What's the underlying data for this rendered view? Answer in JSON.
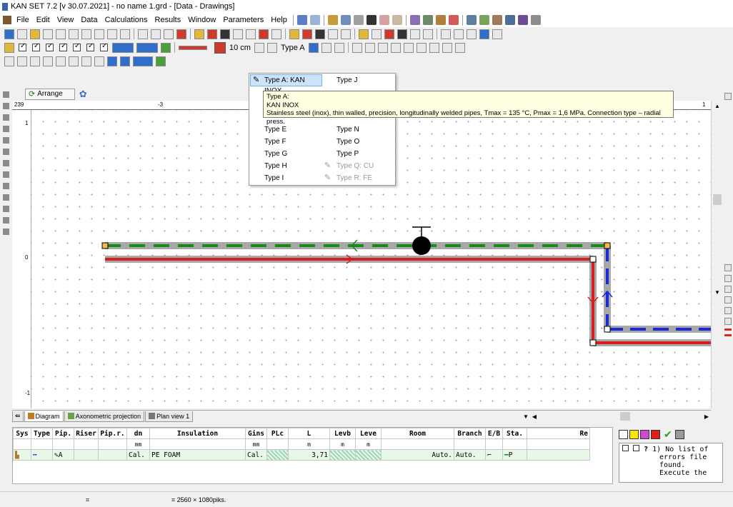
{
  "window": {
    "title": "KAN SET 7.2  [v 30.07.2021] - no name 1.grd - [Data - Drawings]"
  },
  "menu": {
    "items": [
      "File",
      "Edit",
      "View",
      "Data",
      "Calculations",
      "Results",
      "Window",
      "Parameters",
      "Help"
    ]
  },
  "toolbar": {
    "length_label": "10 cm",
    "pipe_type_label": "Type A"
  },
  "arrange": {
    "label": "Arrange"
  },
  "rulers": {
    "h_start": "239",
    "h_mid": "-3",
    "h_end": "1",
    "v_top": "1",
    "v_mid": "0",
    "v_bottom": "-1"
  },
  "dropdown": {
    "items": [
      {
        "label": "Type A: KAN INOX"
      },
      {
        "label": "Type J"
      },
      {
        "label": "Type E"
      },
      {
        "label": "Type N"
      },
      {
        "label": "Type F"
      },
      {
        "label": "Type O"
      },
      {
        "label": "Type G"
      },
      {
        "label": "Type P"
      },
      {
        "label": "Type H"
      },
      {
        "label": "Type Q: CU"
      },
      {
        "label": "Type I"
      },
      {
        "label": "Type R: FE"
      }
    ]
  },
  "tooltip": {
    "line1": "Type A:",
    "line2": "KAN INOX",
    "line3": "Stainless steel (inox), thin walled, precision, longitudinally welded pipes, Tmax = 135 °C, Pmax = 1,6 MPa. Connection type – radial press."
  },
  "tabs": [
    {
      "label": "Diagram"
    },
    {
      "label": "Axonometric projection"
    },
    {
      "label": "Plan view 1"
    }
  ],
  "table": {
    "headers": [
      "Sys",
      "Type",
      "Pip.",
      "Riser",
      "Pip.r.",
      "dn",
      "Insulation",
      "Gins",
      "PLc",
      "L",
      "Levb",
      "Leve",
      "Room",
      "Branch",
      "E/B",
      "Sta.",
      "Re"
    ],
    "units": [
      "",
      "",
      "",
      "",
      "",
      "mm",
      "",
      "mm",
      "",
      "m",
      "m",
      "m",
      "",
      "",
      "",
      "",
      ""
    ],
    "row": {
      "pip": "A",
      "dn": "Cal.",
      "insulation": "PE FOAM",
      "gins": "Cal.",
      "length": "3,71",
      "room": "Auto.",
      "branch": "Auto.",
      "sta": "P"
    }
  },
  "errors": {
    "number": "1)",
    "text_lines": [
      "No list of",
      "errors file",
      "found.",
      "Execute the"
    ]
  },
  "status": {
    "resolution": "2560 × 1080piks."
  },
  "colors": {
    "supply": "#d62020",
    "return": "#1a8a1a",
    "riser": "#1a2bd6",
    "insulation": "#a8a8a8"
  }
}
